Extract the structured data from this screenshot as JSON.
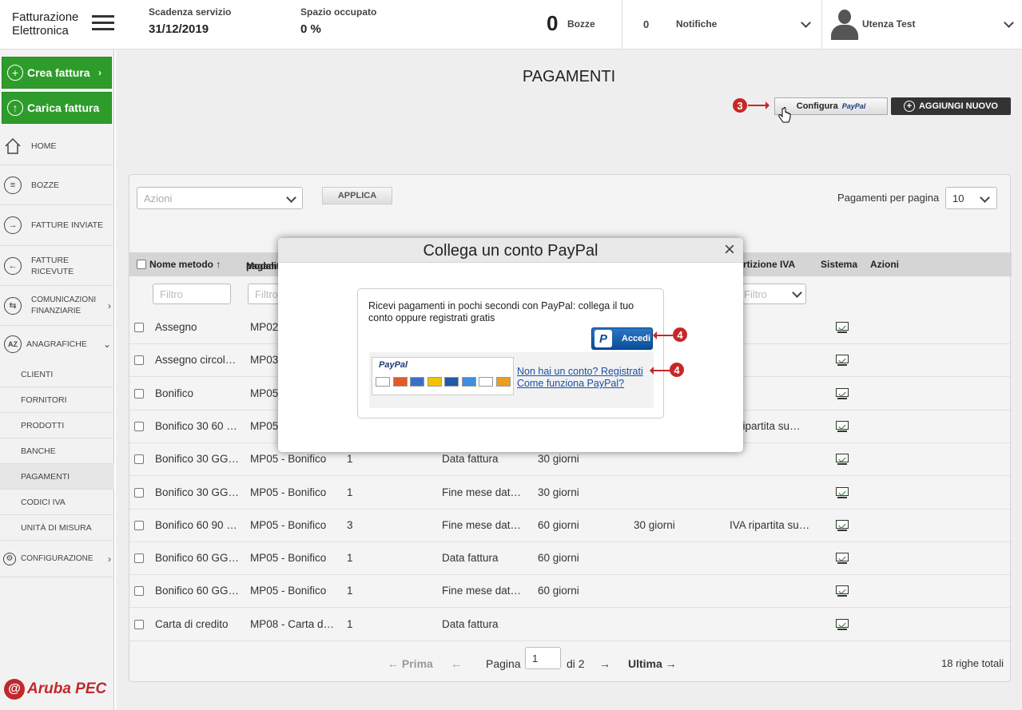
{
  "app": {
    "title_line1": "Fatturazione",
    "title_line2": "Elettronica"
  },
  "header": {
    "scadenza_label": "Scadenza servizio",
    "scadenza_value": "31/12/2019",
    "spazio_label": "Spazio occupato",
    "spazio_value": "0 %",
    "bozze_count": "0",
    "bozze_label": "Bozze",
    "notifiche_count": "0",
    "notifiche_label": "Notifiche",
    "user": "Utenza Test"
  },
  "sidebar": {
    "crea": "Crea fattura",
    "carica": "Carica fattura",
    "home": "HOME",
    "bozze": "BOZZE",
    "inviate": "FATTURE INVIATE",
    "ricevute1": "FATTURE",
    "ricevute2": "RICEVUTE",
    "comunicazioni1": "COMUNICAZIONI",
    "comunicazioni2": "FINANZIARIE",
    "anagrafiche": "ANAGRAFICHE",
    "sub": [
      "CLIENTI",
      "FORNITORI",
      "PRODOTTI",
      "BANCHE",
      "PAGAMENTI",
      "CODICI IVA",
      "UNITÀ DI MISURA"
    ],
    "configurazione": "CONFIGURAZIONE",
    "brand": "Aruba PEC"
  },
  "page": {
    "title": "PAGAMENTI",
    "configura": "Configura",
    "paypal_word": "PayPal",
    "aggiungi": "AGGIUNGI NUOVO",
    "step3": "3",
    "step4": "4",
    "azioni_placeholder": "Azioni",
    "applica": "APPLICA",
    "per_pagina_label": "Pagamenti per pagina",
    "per_pagina_value": "10",
    "filter_placeholder": "Filtro"
  },
  "table": {
    "headers": {
      "nome": "Nome metodo ↑",
      "modalita1": "Modalit",
      "modalita2": "pagame",
      "ripartizione": "rtizione IVA",
      "sistema": "Sistema",
      "azioni": "Azioni"
    },
    "rows": [
      {
        "nome": "Assegno",
        "mod": "MP02",
        "n": "",
        "dec": "",
        "gg1": "",
        "gg2": "",
        "iva": ""
      },
      {
        "nome": "Assegno circol…",
        "mod": "MP03",
        "n": "",
        "dec": "",
        "gg1": "",
        "gg2": "",
        "iva": ""
      },
      {
        "nome": "Bonifico",
        "mod": "MP05",
        "n": "",
        "dec": "",
        "gg1": "",
        "gg2": "",
        "iva": ""
      },
      {
        "nome": "Bonifico 30 60 …",
        "mod": "MP05",
        "n": "",
        "dec": "",
        "gg1": "",
        "gg2": "",
        "iva": "A ripartita su…"
      },
      {
        "nome": "Bonifico 30 GG…",
        "mod": "MP05 - Bonifico",
        "n": "1",
        "dec": "Data fattura",
        "gg1": "30 giorni",
        "gg2": "",
        "iva": ""
      },
      {
        "nome": "Bonifico 30 GG…",
        "mod": "MP05 - Bonifico",
        "n": "1",
        "dec": "Fine mese dat…",
        "gg1": "30 giorni",
        "gg2": "",
        "iva": ""
      },
      {
        "nome": "Bonifico 60 90 …",
        "mod": "MP05 - Bonifico",
        "n": "3",
        "dec": "Fine mese dat…",
        "gg1": "60 giorni",
        "gg2": "30 giorni",
        "iva": "IVA ripartita su…"
      },
      {
        "nome": "Bonifico 60 GG…",
        "mod": "MP05 - Bonifico",
        "n": "1",
        "dec": "Data fattura",
        "gg1": "60 giorni",
        "gg2": "",
        "iva": ""
      },
      {
        "nome": "Bonifico 60 GG…",
        "mod": "MP05 - Bonifico",
        "n": "1",
        "dec": "Fine mese dat…",
        "gg1": "60 giorni",
        "gg2": "",
        "iva": ""
      },
      {
        "nome": "Carta di credito",
        "mod": "MP08 - Carta d…",
        "n": "1",
        "dec": "Data fattura",
        "gg1": "",
        "gg2": "",
        "iva": ""
      }
    ]
  },
  "pager": {
    "prima": "← Prima",
    "prev": "←",
    "pagina": "Pagina",
    "current": "1",
    "di": "di 2",
    "next": "→",
    "ultima": "Ultima →",
    "totale": "18 righe totali"
  },
  "modal": {
    "title": "Collega un conto PayPal",
    "close": "×",
    "text": "Ricevi pagamenti in pochi secondi con PayPal: collega il tuo conto oppure registrati gratis",
    "accedi": "Accedi",
    "paypal_logo": "PayPal",
    "link_registrati": "Non hai un conto? Registrati",
    "link_come": "Come funziona PayPal?",
    "cards": [
      "VISA",
      "MC",
      "AMEX",
      "PP",
      "Maestro",
      "AMEX2",
      "DISCOVER",
      "Aura"
    ]
  }
}
